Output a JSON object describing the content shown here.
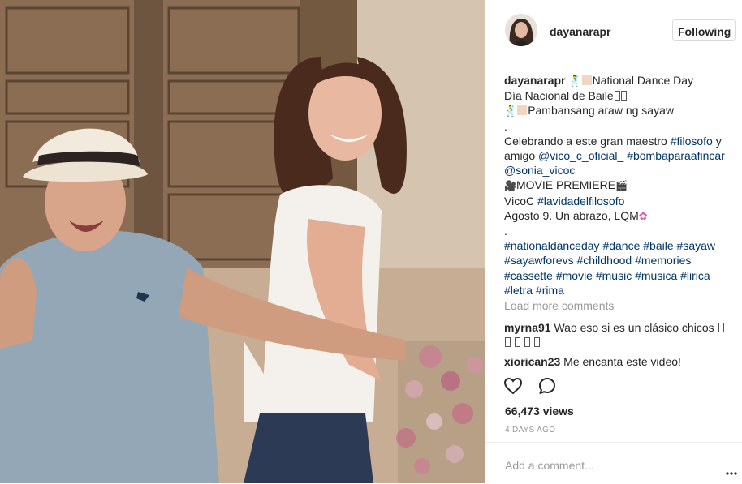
{
  "header": {
    "username": "dayanarapr",
    "follow_label": "Following"
  },
  "caption": {
    "username": "dayanarapr",
    "lines": [
      "National Dance Day",
      "Día Nacional de Baile",
      "Pambansang araw ng sayaw",
      ".",
      "Celebrando a este gran maestro",
      "#filosofo",
      "y",
      "amigo",
      "@vico_c_oficial_",
      "#bombaparaafincar",
      "@sonia_vicoc",
      "MOVIE PREMIERE",
      "VicoC",
      "#lavidadelfilosofo",
      "Agosto 9. Un abrazo, LQM",
      ".",
      "#nationaldanceday",
      "#dance",
      "#baile",
      "#sayaw",
      "#sayawforevs",
      "#childhood",
      "#memories",
      "#cassette",
      "#movie",
      "#music",
      "#musica",
      "#lirica",
      "#letra",
      "#rima"
    ]
  },
  "load_more": "Load more comments",
  "comments": [
    {
      "user": "myrna91",
      "text": "Wao eso si es un clásico chicos"
    },
    {
      "user": "xiorican23",
      "text": "Me encanta este video!"
    }
  ],
  "views": "66,473 views",
  "time_ago": "4 DAYS AGO",
  "add_comment_placeholder": "Add a comment...",
  "icons": {
    "like": "heart-icon",
    "comment": "comment-icon",
    "more": "more-options-icon"
  }
}
